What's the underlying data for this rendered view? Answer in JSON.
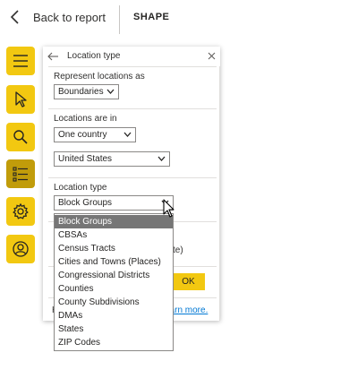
{
  "topbar": {
    "back_label": "Back to report",
    "title": "SHAPE"
  },
  "tools": [
    {
      "name": "menu-icon",
      "active": false
    },
    {
      "name": "pointer-icon",
      "active": false
    },
    {
      "name": "search-icon",
      "active": false
    },
    {
      "name": "list-icon",
      "active": true
    },
    {
      "name": "gear-icon",
      "active": false
    },
    {
      "name": "user-icon",
      "active": false
    }
  ],
  "panel": {
    "title": "Location type",
    "represent_label": "Represent locations as",
    "represent_value": "Boundaries",
    "locations_in_label": "Locations are in",
    "country_scope_value": "One country",
    "country_value": "United States",
    "location_type_label": "Location type",
    "location_type_value": "Block Groups",
    "hidden_text_fragment": "te)",
    "ok_label": "OK",
    "footer_fragment": "H",
    "learn_more": "earn more."
  },
  "dropdown": {
    "selected": "Block Groups",
    "options": [
      "Block Groups",
      "CBSAs",
      "Census Tracts",
      "Cities and Towns (Places)",
      "Congressional Districts",
      "Counties",
      "County Subdivisions",
      "DMAs",
      "States",
      "ZIP Codes"
    ]
  },
  "colors": {
    "accent": "#f2c811",
    "accent_active": "#c19c0a",
    "selected_option": "#767676",
    "link": "#0078d4"
  }
}
